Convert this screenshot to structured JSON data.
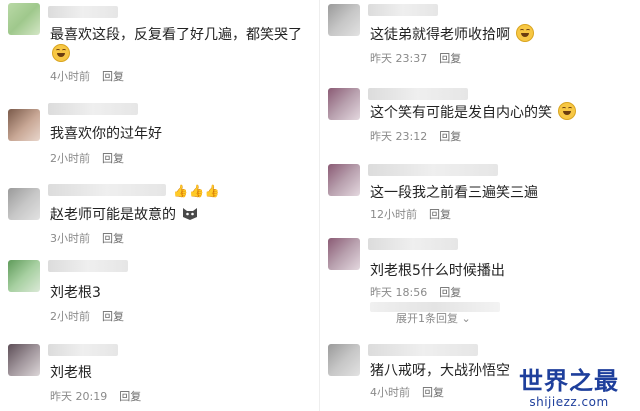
{
  "left_comments": [
    {
      "text": "最喜欢这段，反复看了好几遍，都笑哭了",
      "time": "4小时前",
      "reply": "回复"
    },
    {
      "text": "我喜欢你的过年好",
      "time": "2小时前",
      "reply": "回复"
    },
    {
      "text": "赵老师可能是故意的",
      "time": "3小时前",
      "reply": "回复"
    },
    {
      "text": "刘老根3",
      "time": "2小时前",
      "reply": "回复"
    },
    {
      "text": "刘老根",
      "time": "昨天 20:19",
      "reply": "回复"
    }
  ],
  "right_comments": [
    {
      "text": "这徒弟就得老师收拾啊",
      "time": "昨天 23:37",
      "reply": "回复"
    },
    {
      "text": "这个笑有可能是发自内心的笑",
      "time": "昨天 23:12",
      "reply": "回复"
    },
    {
      "text": "这一段我之前看三遍笑三遍",
      "time": "12小时前",
      "reply": "回复"
    },
    {
      "text": "刘老根5什么时候播出",
      "time": "昨天 18:56",
      "reply": "回复",
      "expand": "展开1条回复"
    },
    {
      "text": "猪八戒呀，大战孙悟空",
      "time": "4小时前",
      "reply": "回复"
    }
  ],
  "icons": {
    "laugh": "laughing-with-tears-emoji",
    "thumb": "thumbs-up-emoji",
    "cat": "cat-face-emoji"
  },
  "watermark": {
    "title": "世界之最",
    "url": "shijiezz.com"
  },
  "colors": {
    "meta_text": "#8a8a8a",
    "body_text": "#222222",
    "watermark": "#1e3f9c"
  }
}
